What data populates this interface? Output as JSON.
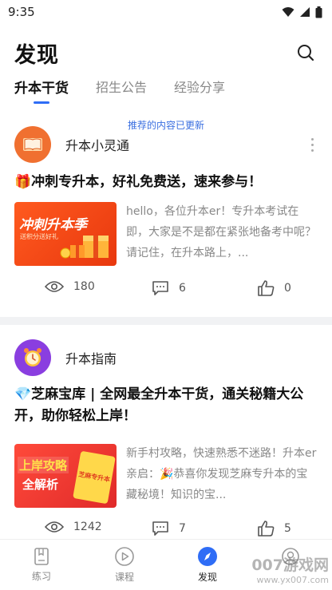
{
  "status_bar": {
    "time": "9:35"
  },
  "header": {
    "title": "发现"
  },
  "tabs": [
    {
      "label": "升本干货",
      "active": true
    },
    {
      "label": "招生公告",
      "active": false
    },
    {
      "label": "经验分享",
      "active": false
    }
  ],
  "update_note": "推荐的内容已更新",
  "posts": [
    {
      "author": "升本小灵通",
      "title": "🎁冲刺专升本，好礼免费送，速来参与！",
      "thumb_title": "冲刺升本季",
      "thumb_subtitle": "送积分送好礼",
      "excerpt": "hello，各位升本er！专升本考试在即，大家是不是都在紧张地备考中呢？请记住，在升本路上，...",
      "views": "180",
      "comments": "6",
      "likes": "0"
    },
    {
      "author": "升本指南",
      "title": "💎芝麻宝库 | 全网最全升本干货，通关秘籍大公开，助你轻松上岸！",
      "thumb_title": "上岸攻略",
      "thumb_subtitle": "全解析",
      "thumb_book": "芝麻专升本",
      "excerpt": "新手村攻略，快速熟悉不迷路！升本er亲启：🎉恭喜你发现芝麻专升本的宝藏秘境！知识的宝...",
      "views": "1242",
      "comments": "7",
      "likes": "5"
    }
  ],
  "bottom_nav": [
    {
      "label": "练习",
      "icon": "book-icon",
      "active": false
    },
    {
      "label": "课程",
      "icon": "play-icon",
      "active": false
    },
    {
      "label": "发现",
      "icon": "compass-icon",
      "active": true
    },
    {
      "label": "我的",
      "icon": "user-icon",
      "active": false
    }
  ],
  "watermark": {
    "main": "007游戏网",
    "sub": "www.yx007.com"
  },
  "colors": {
    "accent": "#2f6df6",
    "text": "#222222",
    "muted": "#888888",
    "thumb_orange": "#f0521c"
  }
}
